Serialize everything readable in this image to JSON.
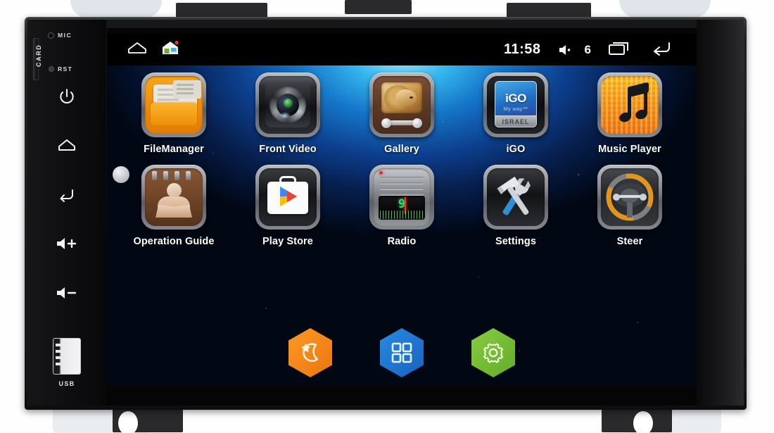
{
  "device": {
    "name": "car-head-unit",
    "left_panel": {
      "mic_label": "MIC",
      "card_label": "CARD",
      "rst_label": "RST",
      "usb_label": "USB",
      "buttons": [
        {
          "name": "power-button",
          "icon": "power-icon"
        },
        {
          "name": "home-button",
          "icon": "home-icon"
        },
        {
          "name": "back-button",
          "icon": "back-arrow-icon"
        },
        {
          "name": "volume-up-button",
          "icon": "volume-up-icon"
        },
        {
          "name": "volume-down-button",
          "icon": "volume-down-icon"
        }
      ]
    }
  },
  "statusbar": {
    "home_icon": "home-outline-icon",
    "launcher_icon": "house-app-icon",
    "time": "11:58",
    "volume_icon": "speaker-icon",
    "volume_level": "6",
    "recents_icon": "recents-icon",
    "back_icon": "back-arrow-icon"
  },
  "apps": [
    {
      "label": "FileManager",
      "icon": "file-manager-icon"
    },
    {
      "label": "Front Video",
      "icon": "camera-icon"
    },
    {
      "label": "Gallery",
      "icon": "gallery-icon"
    },
    {
      "label": "iGO",
      "icon": "igo-navigation-icon"
    },
    {
      "label": "Music Player",
      "icon": "music-note-icon"
    },
    {
      "label": "Operation Guide",
      "icon": "manual-book-icon"
    },
    {
      "label": "Play Store",
      "icon": "play-store-icon"
    },
    {
      "label": "Radio",
      "icon": "radio-icon"
    },
    {
      "label": "Settings",
      "icon": "tools-icon"
    },
    {
      "label": "Steer",
      "icon": "steering-wheel-icon"
    }
  ],
  "icon_text": {
    "igo_title": "iGO",
    "igo_subtitle": "My way™",
    "igo_region": "ISRAEL",
    "radio_display": "9"
  },
  "dock": [
    {
      "name": "night-mode-button",
      "icon": "moon-star-icon",
      "color": "#f5871a"
    },
    {
      "name": "all-apps-button",
      "icon": "grid-squares-icon",
      "color": "#1f76d2"
    },
    {
      "name": "settings-button",
      "icon": "gear-icon",
      "color": "#73bd33"
    }
  ],
  "colors": {
    "wallpaper_glow": "#35b6ee",
    "wallpaper_deep": "#03102b",
    "statusbar": "#000000",
    "label_text": "#ffffff"
  }
}
